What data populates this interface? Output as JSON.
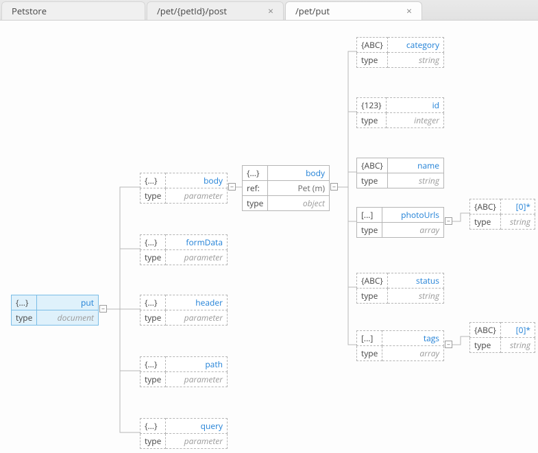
{
  "tabs": {
    "main": "Petstore",
    "t1": "/pet/{petId}/post",
    "t2": "/pet/put",
    "close": "×"
  },
  "badges": {
    "obj": "{...}",
    "abc": "{ABC}",
    "num": "{123}",
    "arr": "[...]"
  },
  "labels": {
    "type": "type",
    "ref": "ref:"
  },
  "nodes": {
    "root": {
      "name": "put",
      "type": "document"
    },
    "body": {
      "name": "body",
      "type": "parameter"
    },
    "formData": {
      "name": "formData",
      "type": "parameter"
    },
    "header": {
      "name": "header",
      "type": "parameter"
    },
    "path": {
      "name": "path",
      "type": "parameter"
    },
    "query": {
      "name": "query",
      "type": "parameter"
    },
    "bodyObj": {
      "name": "body",
      "ref": "Pet (m)",
      "type": "object"
    },
    "category": {
      "name": "category",
      "type": "string"
    },
    "id": {
      "name": "id",
      "type": "integer"
    },
    "name": {
      "name": "name",
      "type": "string"
    },
    "photoUrls": {
      "name": "photoUrls",
      "type": "array"
    },
    "photoItem": {
      "name": "[0]*",
      "type": "string"
    },
    "status": {
      "name": "status",
      "type": "string"
    },
    "tags": {
      "name": "tags",
      "type": "array"
    },
    "tagsItem": {
      "name": "[0]*",
      "type": "string"
    }
  },
  "toggle": {
    "minus": "−"
  }
}
